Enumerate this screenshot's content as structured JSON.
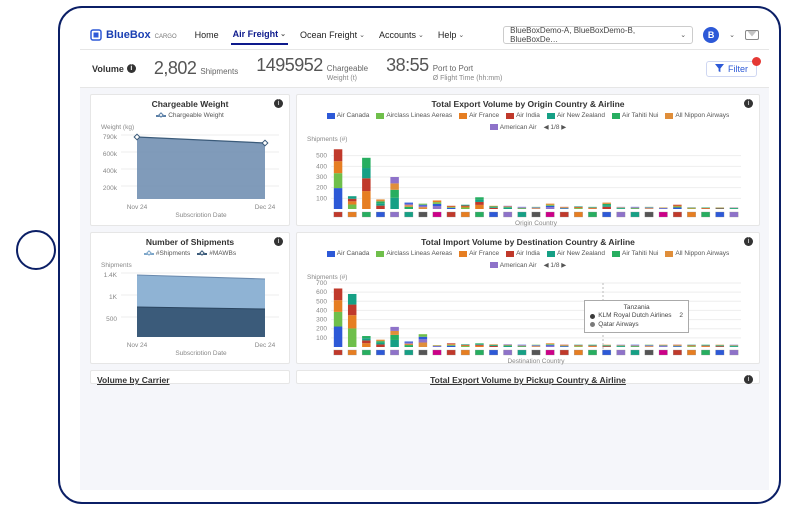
{
  "brand": {
    "name": "BlueBox",
    "sub": "CARGO"
  },
  "nav": {
    "home": "Home",
    "air": "Air Freight",
    "ocean": "Ocean Freight",
    "accounts": "Accounts",
    "help": "Help"
  },
  "selector": "BlueBoxDemo-A, BlueBoxDemo-B, BlueBoxDe…",
  "avatar_initial": "B",
  "kpi": {
    "section": "Volume",
    "shipments_n": "2,802",
    "shipments_l": "Shipments",
    "chargeable_n": "1495952",
    "chargeable_l": "Chargeable",
    "chargeable_sub": "Weight (t)",
    "port_n": "38:55",
    "port_l": "Port to Port",
    "port_sub": "Ø Flight Time (hh:mm)",
    "filter": "Filter"
  },
  "legend_page": "1/8",
  "airlines": [
    {
      "name": "Air Canada",
      "color": "#2d59d7"
    },
    {
      "name": "Airclass Lineas Aereas",
      "color": "#6fbf4b"
    },
    {
      "name": "Air France",
      "color": "#e67e22"
    },
    {
      "name": "Air India",
      "color": "#c0392b"
    },
    {
      "name": "Air New Zealand",
      "color": "#16a085"
    },
    {
      "name": "Air Tahiti Nui",
      "color": "#27ae60"
    },
    {
      "name": "All Nippon Airways",
      "color": "#e08e3a"
    },
    {
      "name": "American Air",
      "color": "#8e72c9"
    }
  ],
  "cards": {
    "cw": {
      "title": "Chargeable Weight",
      "legend": "Chargeable Weight",
      "ylabel": "Weight (kg)",
      "xlabel": "Subscription Date",
      "xticks": [
        "Nov 24",
        "Dec 24"
      ]
    },
    "ns": {
      "title": "Number of Shipments",
      "legend_a": "#Shipments",
      "legend_b": "#MAWBs",
      "ylabel": "Shipments",
      "xlabel": "Subscription Date",
      "xticks": [
        "Nov 24",
        "Dec 24"
      ]
    },
    "exp": {
      "title": "Total Export Volume by Origin Country & Airline",
      "ylabel": "Shipments (#)",
      "xlabel": "Origin Country"
    },
    "imp": {
      "title": "Total Import Volume by Destination Country & Airline",
      "ylabel": "Shipments (#)",
      "xlabel": "Destination Country"
    },
    "vbc": {
      "title": "Volume by Carrier"
    },
    "exp2": {
      "title": "Total Export Volume by Pickup Country & Airline"
    }
  },
  "tooltip": {
    "country": "Tanzania",
    "rows": [
      {
        "label": "KLM Royal Dutch Airlines",
        "value": "2",
        "color": "#3b3b3b"
      },
      {
        "label": "Qatar Airways",
        "value": "",
        "color": "#7a7a7a"
      }
    ]
  },
  "chart_data": [
    {
      "id": "chargeable_weight",
      "type": "area",
      "x": [
        "Nov 24",
        "Dec 24"
      ],
      "values": [
        780000,
        720000
      ],
      "ylim": [
        0,
        790000
      ],
      "yticks": [
        "200k",
        "400k",
        "600k",
        "790k"
      ],
      "ylabel": "Weight (kg)",
      "xlabel": "Subscription Date"
    },
    {
      "id": "number_of_shipments",
      "type": "area-stacked",
      "x": [
        "Nov 24",
        "Dec 24"
      ],
      "series": [
        {
          "name": "#MAWBs",
          "values": [
            700,
            650
          ],
          "color": "#3b5b7a"
        },
        {
          "name": "#Shipments",
          "values": [
            1450,
            1350
          ],
          "color": "#7da6c9"
        }
      ],
      "ylim": [
        0,
        1450
      ],
      "yticks": [
        "500",
        "1K",
        "1.4K"
      ],
      "ylabel": "Shipments",
      "xlabel": "Subscription Date"
    },
    {
      "id": "export_by_origin",
      "type": "bar-stacked",
      "ylabel": "Shipments (#)",
      "xlabel": "Origin Country",
      "ylim": [
        0,
        600
      ],
      "yticks": [
        100,
        200,
        300,
        400,
        500
      ],
      "n_categories": 29,
      "series_top": [
        560,
        120,
        480,
        90,
        300,
        60,
        50,
        80,
        30,
        40,
        110,
        30,
        30,
        20,
        20,
        50,
        20,
        25,
        20,
        60,
        20,
        20,
        20,
        15,
        40,
        15,
        15,
        15,
        15
      ]
    },
    {
      "id": "import_by_destination",
      "type": "bar-stacked",
      "ylabel": "Shipments (#)",
      "xlabel": "Destination Country",
      "ylim": [
        0,
        700
      ],
      "yticks": [
        100,
        200,
        300,
        400,
        500,
        600,
        700
      ],
      "n_categories": 29,
      "series_top": [
        640,
        580,
        120,
        80,
        220,
        60,
        140,
        20,
        40,
        30,
        40,
        30,
        30,
        25,
        25,
        40,
        25,
        25,
        25,
        25,
        25,
        25,
        25,
        25,
        25,
        25,
        25,
        25,
        25
      ]
    }
  ]
}
